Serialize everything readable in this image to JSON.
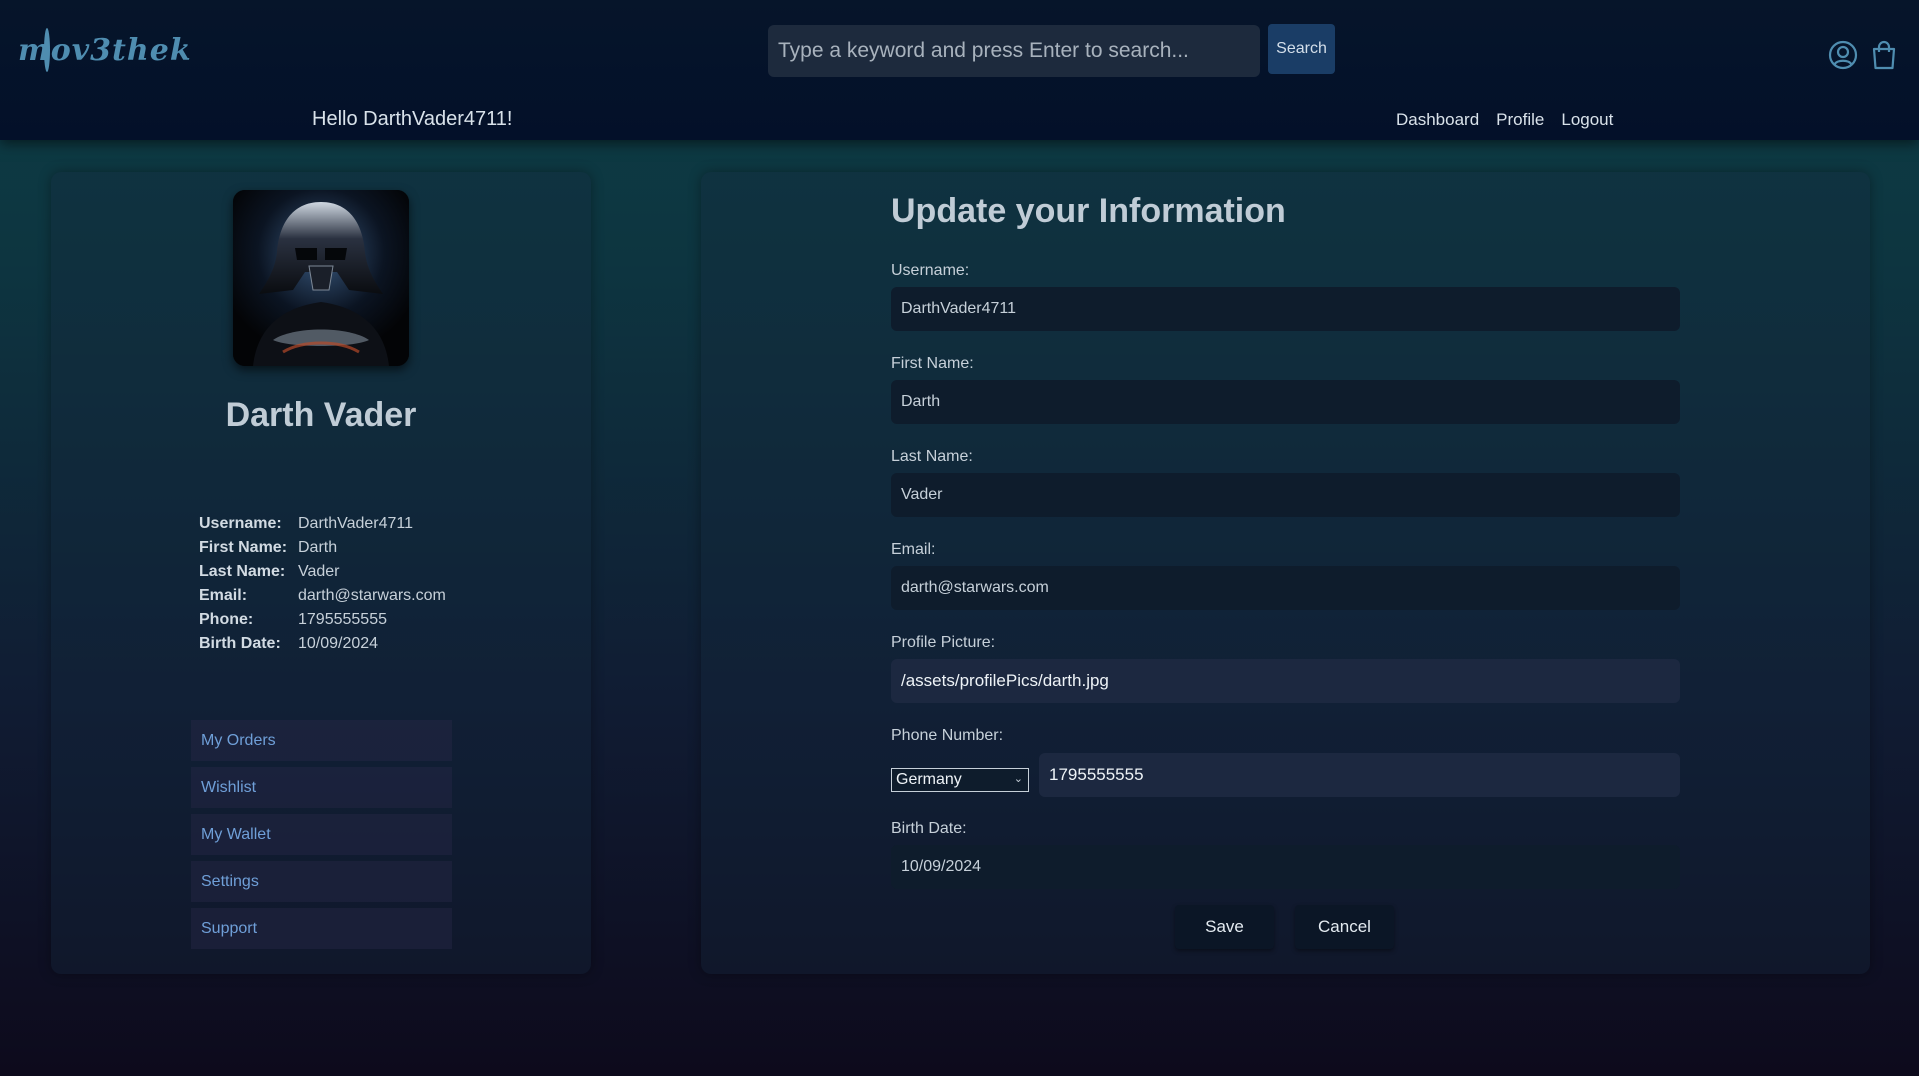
{
  "brand": {
    "logo_text": "mov3thek"
  },
  "search": {
    "placeholder": "Type a keyword and press Enter to search...",
    "button_label": "Search"
  },
  "header": {
    "greeting": "Hello DarthVader4711!",
    "nav": [
      "Dashboard",
      "Profile",
      "Logout"
    ],
    "icons": [
      "user-icon",
      "shopping-bag-icon"
    ]
  },
  "profile": {
    "full_name": "Darth Vader",
    "avatar": "darth-vader-avatar",
    "info": [
      {
        "label": "Username:",
        "value": "DarthVader4711"
      },
      {
        "label": "First Name:",
        "value": "Darth"
      },
      {
        "label": "Last Name:",
        "value": "Vader"
      },
      {
        "label": "Email:",
        "value": "darth@starwars.com"
      },
      {
        "label": "Phone:",
        "value": "1795555555"
      },
      {
        "label": "Birth Date:",
        "value": "10/09/2024"
      }
    ],
    "menu": [
      "My Orders",
      "Wishlist",
      "My Wallet",
      "Settings",
      "Support"
    ]
  },
  "form": {
    "title": "Update your Information",
    "username": {
      "label": "Username:",
      "value": "DarthVader4711"
    },
    "first_name": {
      "label": "First Name:",
      "value": "Darth"
    },
    "last_name": {
      "label": "Last Name:",
      "value": "Vader"
    },
    "email": {
      "label": "Email:",
      "value": "darth@starwars.com"
    },
    "profile_picture": {
      "label": "Profile Picture:",
      "value": "/assets/profilePics/darth.jpg"
    },
    "phone": {
      "label": "Phone Number:",
      "country": "Germany",
      "value": "1795555555"
    },
    "birth_date": {
      "label": "Birth Date:",
      "value": "10/09/2024"
    },
    "save_label": "Save",
    "cancel_label": "Cancel"
  },
  "colors": {
    "accent_link": "#6f9fd8",
    "search_button": "#1a3d66",
    "logo": "#4f8db0"
  }
}
